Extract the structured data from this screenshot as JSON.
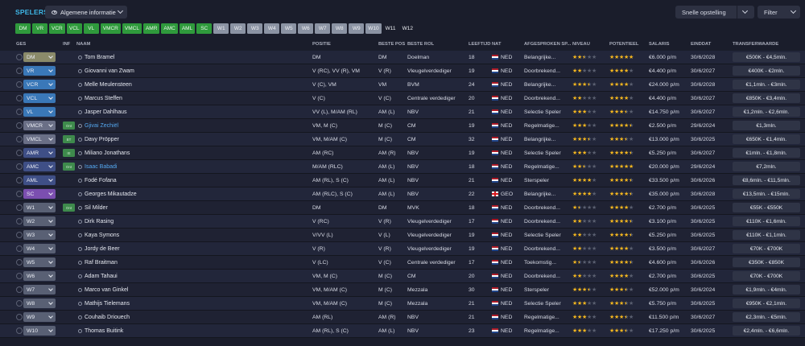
{
  "header": {
    "title": "SPELERS",
    "view_label": "Algemene informatie",
    "quick_label": "Snelle opstelling",
    "filter_label": "Filter"
  },
  "chips": [
    {
      "label": "DM",
      "style": "green"
    },
    {
      "label": "VR",
      "style": "green"
    },
    {
      "label": "VCR",
      "style": "green"
    },
    {
      "label": "VCL",
      "style": "green"
    },
    {
      "label": "VL",
      "style": "green"
    },
    {
      "label": "VMCR",
      "style": "green"
    },
    {
      "label": "VMCL",
      "style": "green"
    },
    {
      "label": "AMR",
      "style": "green"
    },
    {
      "label": "AMC",
      "style": "green"
    },
    {
      "label": "AML",
      "style": "green"
    },
    {
      "label": "SC",
      "style": "green"
    },
    {
      "label": "W1",
      "style": "gray"
    },
    {
      "label": "W2",
      "style": "gray"
    },
    {
      "label": "W3",
      "style": "gray"
    },
    {
      "label": "W4",
      "style": "gray"
    },
    {
      "label": "W5",
      "style": "gray"
    },
    {
      "label": "W6",
      "style": "gray"
    },
    {
      "label": "W7",
      "style": "gray"
    },
    {
      "label": "W8",
      "style": "gray"
    },
    {
      "label": "W9",
      "style": "gray"
    },
    {
      "label": "W10",
      "style": "gray"
    },
    {
      "label": "W11",
      "style": "dark"
    },
    {
      "label": "W12",
      "style": "dark"
    }
  ],
  "columns": {
    "ges": "GES",
    "inf": "INF",
    "naam": "NAAM",
    "positie": "POSITIE",
    "beste_pos": "BESTE POS",
    "beste_rol": "BESTE ROL",
    "leeftijd": "LEEFTIJD",
    "nat": "NAT",
    "afgesproken": "AFGESPROKEN SP...",
    "niveau": "NIVEAU",
    "potentieel": "POTENTIEEL",
    "salaris": "SALARIS",
    "einddat": "EINDDAT",
    "transferwaarde": "TRANSFERWAARDE"
  },
  "colors": {
    "dm": "#8a8a6a",
    "vr": "#3a78b8",
    "vmc": "#6a6f86",
    "am": "#3f4f86",
    "sc": "#7b4fb0",
    "w": "#596074"
  },
  "players": [
    {
      "pos": "DM",
      "pos_color": "#8a8a6a",
      "inf": "",
      "name": "Tom Bramel",
      "link": false,
      "positie": "DM",
      "bp": "DM",
      "br": "Doelman",
      "age": "18",
      "flag": "ned",
      "nat": "NED",
      "role": "Belangrijke...",
      "niveau": 2.5,
      "pot": 5,
      "salary": "€6.000 p/m",
      "end": "30/6/2028",
      "tv": "€500K - €4,5mln."
    },
    {
      "pos": "VR",
      "pos_color": "#3a78b8",
      "inf": "",
      "name": "Giovanni van Zwam",
      "link": false,
      "positie": "V (RC), VV (R), VM",
      "bp": "V (R)",
      "br": "Vleugelverdediger",
      "age": "19",
      "flag": "ned",
      "nat": "NED",
      "role": "Doorbrekend...",
      "niveau": 2,
      "pot": 4,
      "salary": "€4.400 p/m",
      "end": "30/6/2027",
      "tv": "€400K - €2mln."
    },
    {
      "pos": "VCR",
      "pos_color": "#3a78b8",
      "inf": "",
      "name": "Melle Meulensteen",
      "link": false,
      "positie": "V (C), VM",
      "bp": "VM",
      "br": "BVM",
      "age": "24",
      "flag": "ned",
      "nat": "NED",
      "role": "Belangrijke...",
      "niveau": 3.5,
      "pot": 4,
      "salary": "€24.000 p/m",
      "end": "30/6/2028",
      "tv": "€1,1mln. - €3mln."
    },
    {
      "pos": "VCL",
      "pos_color": "#3a78b8",
      "inf": "",
      "name": "Marcus Steffen",
      "link": false,
      "positie": "V (C)",
      "bp": "V (C)",
      "br": "Centrale verdediger",
      "age": "20",
      "flag": "ned",
      "nat": "NED",
      "role": "Doorbrekend...",
      "niveau": 2,
      "pot": 4,
      "salary": "€4.400 p/m",
      "end": "30/6/2027",
      "tv": "€850K - €3,4mln."
    },
    {
      "pos": "VL",
      "pos_color": "#3a78b8",
      "inf": "",
      "name": "Jasper Dahlhaus",
      "link": false,
      "positie": "VV (L), M/AM (RL)",
      "bp": "AM (L)",
      "br": "NBV",
      "age": "21",
      "flag": "ned",
      "nat": "NED",
      "role": "Selectie Speler",
      "niveau": 3,
      "pot": 3.5,
      "salary": "€14.750 p/m",
      "end": "30/6/2027",
      "tv": "€1,2mln. - €2,6mln."
    },
    {
      "pos": "VMCR",
      "pos_color": "#6a6f86",
      "inf": "Ont",
      "name": "Gjivai Zechiël",
      "link": true,
      "positie": "VM, M (C)",
      "bp": "M (C)",
      "br": "CM",
      "age": "19",
      "flag": "ned",
      "nat": "NED",
      "role": "Regelmatige...",
      "niveau": 3,
      "pot": 4.5,
      "salary": "€2.500 p/m",
      "end": "29/6/2024",
      "tv": "€1,3mln."
    },
    {
      "pos": "VMCL",
      "pos_color": "#6a6f86",
      "inf": "BT",
      "name": "Davy Pröpper",
      "link": false,
      "positie": "VM, M/AM (C)",
      "bp": "M (C)",
      "br": "CM",
      "age": "32",
      "flag": "ned",
      "nat": "NED",
      "role": "Belangrijke...",
      "niveau": 3.5,
      "pot": 3.5,
      "salary": "€13.000 p/m",
      "end": "30/6/2025",
      "tv": "€650K - €1,4mln."
    },
    {
      "pos": "AMR",
      "pos_color": "#3f4f86",
      "inf": "IE",
      "name": "Miliano Jonathans",
      "link": false,
      "positie": "AM (RC)",
      "bp": "AM (R)",
      "br": "NBV",
      "age": "19",
      "flag": "ned",
      "nat": "NED",
      "role": "Selectie Speler",
      "niveau": 3,
      "pot": 4.5,
      "salary": "€5.250 p/m",
      "end": "30/6/2027",
      "tv": "€1mln. - €1,8mln."
    },
    {
      "pos": "AMC",
      "pos_color": "#3f4f86",
      "inf": "Ont",
      "name": "Isaac Babadi",
      "link": true,
      "positie": "M/AM (RLC)",
      "bp": "AM (L)",
      "br": "NBV",
      "age": "18",
      "flag": "ned",
      "nat": "NED",
      "role": "Regelmatige...",
      "niveau": 2.5,
      "pot": 5,
      "salary": "€20.000 p/m",
      "end": "29/6/2024",
      "tv": "€7,2mln."
    },
    {
      "pos": "AML",
      "pos_color": "#3f4f86",
      "inf": "",
      "name": "Fodé Fofana",
      "link": false,
      "positie": "AM (RL), S (C)",
      "bp": "AM (L)",
      "br": "NBV",
      "age": "21",
      "flag": "ned",
      "nat": "NED",
      "role": "Sterspeler",
      "niveau": 4,
      "pot": 4.5,
      "salary": "€33.500 p/m",
      "end": "30/6/2026",
      "tv": "€8,6mln. - €11,5mln."
    },
    {
      "pos": "SC",
      "pos_color": "#7b4fb0",
      "inf": "",
      "name": "Georges Mikautadze",
      "link": false,
      "positie": "AM (RLC), S (C)",
      "bp": "AM (L)",
      "br": "NBV",
      "age": "22",
      "flag": "geo",
      "nat": "GEO",
      "role": "Belangrijke...",
      "niveau": 4,
      "pot": 4.5,
      "salary": "€35.000 p/m",
      "end": "30/6/2028",
      "tv": "€13,5mln. - €15mln."
    },
    {
      "pos": "W1",
      "pos_color": "#596074",
      "inf": "Ont",
      "name": "Sil Milder",
      "link": false,
      "positie": "DM",
      "bp": "DM",
      "br": "MVK",
      "age": "18",
      "flag": "ned",
      "nat": "NED",
      "role": "Doorbrekend...",
      "niveau": 1.5,
      "pot": 4,
      "salary": "€2.700 p/m",
      "end": "30/6/2025",
      "tv": "€55K - €550K"
    },
    {
      "pos": "W2",
      "pos_color": "#596074",
      "inf": "",
      "name": "Dirk Rasing",
      "link": false,
      "positie": "V (RC)",
      "bp": "V (R)",
      "br": "Vleugelverdediger",
      "age": "17",
      "flag": "ned",
      "nat": "NED",
      "role": "Doorbrekend...",
      "niveau": 2,
      "pot": 4.5,
      "salary": "€3.100 p/m",
      "end": "30/6/2025",
      "tv": "€110K - €1,6mln."
    },
    {
      "pos": "W3",
      "pos_color": "#596074",
      "inf": "",
      "name": "Kaya Symons",
      "link": false,
      "positie": "V/VV (L)",
      "bp": "V (L)",
      "br": "Vleugelverdediger",
      "age": "19",
      "flag": "ned",
      "nat": "NED",
      "role": "Selectie Speler",
      "niveau": 2,
      "pot": 4.5,
      "salary": "€5.250 p/m",
      "end": "30/6/2025",
      "tv": "€110K - €1,1mln."
    },
    {
      "pos": "W4",
      "pos_color": "#596074",
      "inf": "",
      "name": "Jordy de Beer",
      "link": false,
      "positie": "V (R)",
      "bp": "V (R)",
      "br": "Vleugelverdediger",
      "age": "19",
      "flag": "ned",
      "nat": "NED",
      "role": "Doorbrekend...",
      "niveau": 2,
      "pot": 4,
      "salary": "€3.500 p/m",
      "end": "30/6/2027",
      "tv": "€70K - €700K"
    },
    {
      "pos": "W5",
      "pos_color": "#596074",
      "inf": "",
      "name": "Raf Braitman",
      "link": false,
      "positie": "V (LC)",
      "bp": "V (C)",
      "br": "Centrale verdediger",
      "age": "17",
      "flag": "ned",
      "nat": "NED",
      "role": "Toekomstig...",
      "niveau": 1.5,
      "pot": 4.5,
      "salary": "€4.600 p/m",
      "end": "30/6/2026",
      "tv": "€350K - €850K"
    },
    {
      "pos": "W6",
      "pos_color": "#596074",
      "inf": "",
      "name": "Adam Tahaui",
      "link": false,
      "positie": "VM, M (C)",
      "bp": "M (C)",
      "br": "CM",
      "age": "20",
      "flag": "ned",
      "nat": "NED",
      "role": "Doorbrekend...",
      "niveau": 2,
      "pot": 4,
      "salary": "€2.700 p/m",
      "end": "30/6/2025",
      "tv": "€70K - €700K"
    },
    {
      "pos": "W7",
      "pos_color": "#596074",
      "inf": "",
      "name": "Marco van Ginkel",
      "link": false,
      "positie": "VM, M/AM (C)",
      "bp": "M (C)",
      "br": "Mezzala",
      "age": "30",
      "flag": "ned",
      "nat": "NED",
      "role": "Sterspeler",
      "niveau": 3.5,
      "pot": 3.5,
      "salary": "€52.000 p/m",
      "end": "30/6/2024",
      "tv": "€1,9mln. - €4mln."
    },
    {
      "pos": "W8",
      "pos_color": "#596074",
      "inf": "",
      "name": "Mathijs Tielemans",
      "link": false,
      "positie": "VM, M/AM (C)",
      "bp": "M (C)",
      "br": "Mezzala",
      "age": "21",
      "flag": "ned",
      "nat": "NED",
      "role": "Selectie Speler",
      "niveau": 3,
      "pot": 3.5,
      "salary": "€5.750 p/m",
      "end": "30/6/2025",
      "tv": "€950K - €2,1mln."
    },
    {
      "pos": "W9",
      "pos_color": "#596074",
      "inf": "",
      "name": "Couhaib Driouech",
      "link": false,
      "positie": "AM (RL)",
      "bp": "AM (R)",
      "br": "NBV",
      "age": "21",
      "flag": "ned",
      "nat": "NED",
      "role": "Regelmatige...",
      "niveau": 3,
      "pot": 3.5,
      "salary": "€11.500 p/m",
      "end": "30/6/2027",
      "tv": "€2,3mln. - €5mln."
    },
    {
      "pos": "W10",
      "pos_color": "#596074",
      "inf": "",
      "name": "Thomas Buitink",
      "link": false,
      "positie": "AM (RL), S (C)",
      "bp": "AM (L)",
      "br": "NBV",
      "age": "23",
      "flag": "ned",
      "nat": "NED",
      "role": "Regelmatige...",
      "niveau": 3,
      "pot": 3.5,
      "salary": "€17.250 p/m",
      "end": "30/6/2025",
      "tv": "€2,4mln. - €6,6mln."
    }
  ]
}
